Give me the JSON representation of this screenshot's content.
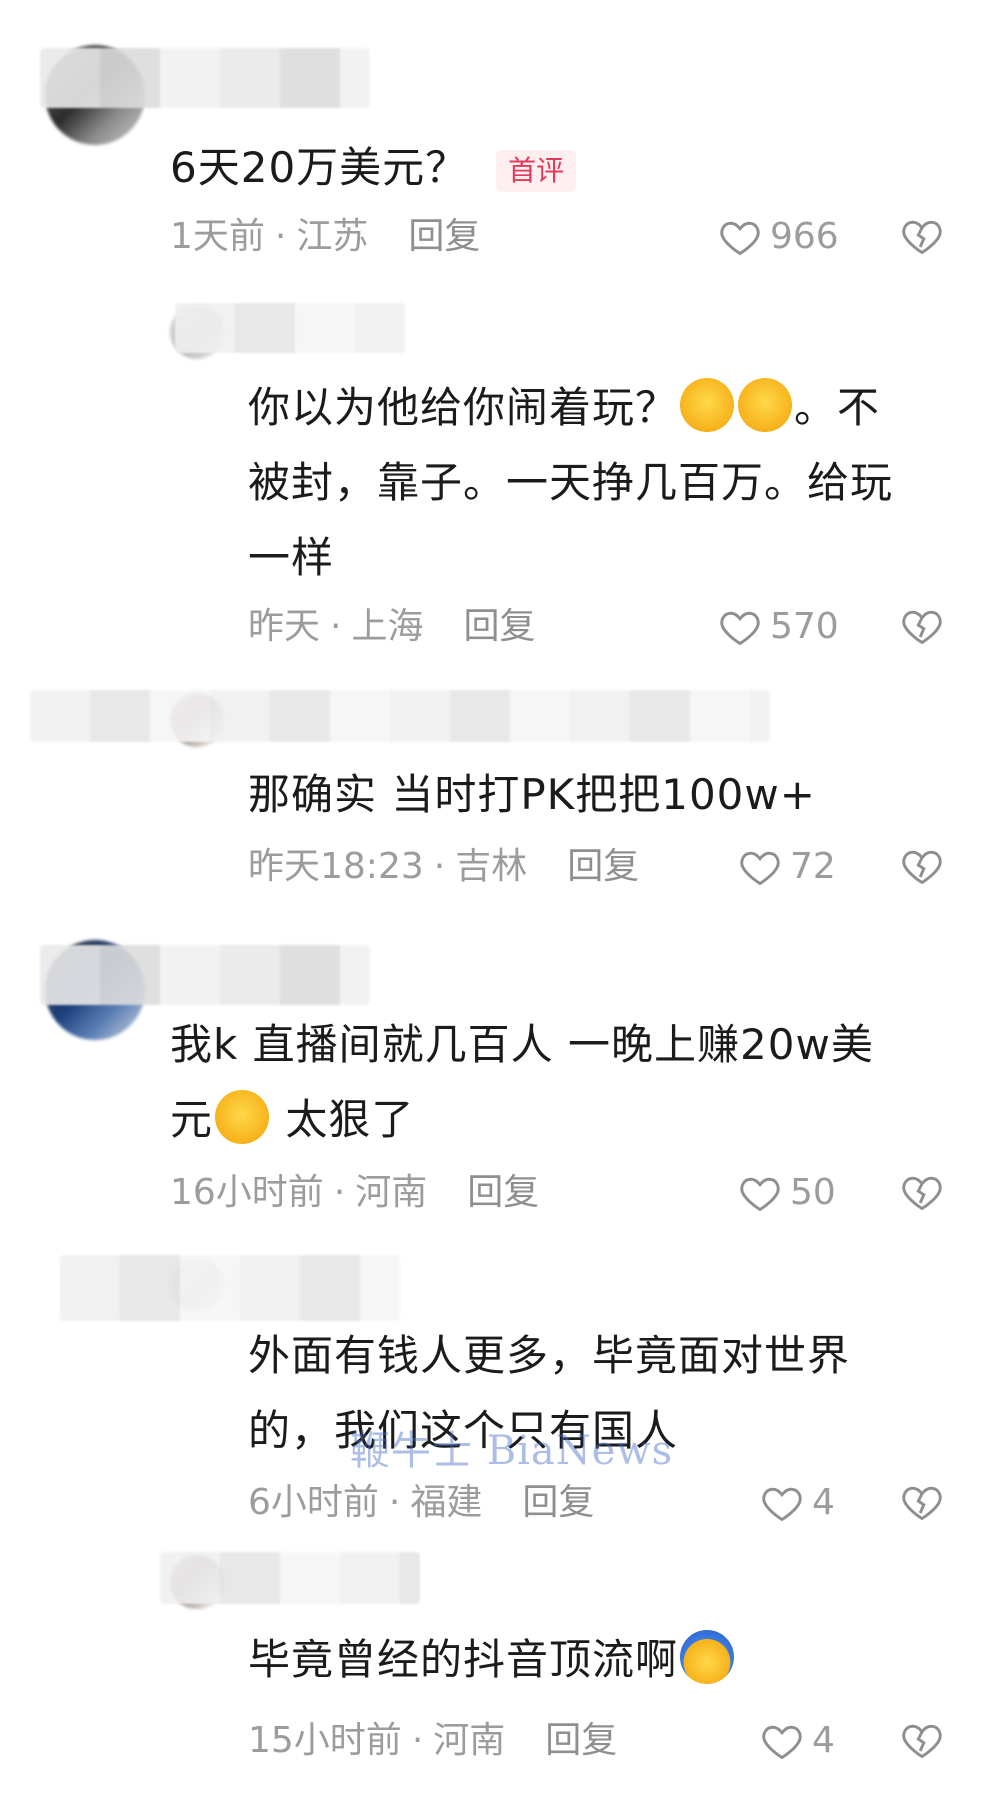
{
  "comments": [
    {
      "text": "6天20万美元？",
      "badge": "首评",
      "time": "1天前",
      "location": "江苏",
      "reply_label": "回复",
      "likes": "966"
    },
    {
      "text_before": "你以为他给你闹着玩？",
      "text_line1_end": "。不",
      "text_line2": "被封，靠子。一天挣几百万。给玩",
      "text_line3": "一样",
      "time": "昨天",
      "location": "上海",
      "reply_label": "回复",
      "likes": "570"
    },
    {
      "text": "那确实 当时打PK把把100w+",
      "time": "昨天18:23",
      "location": "吉林",
      "reply_label": "回复",
      "likes": "72"
    },
    {
      "text_line1": "我k 直播间就几百人 一晚上赚20w美",
      "text_line2_start": "元",
      "text_line2_end": " 太狠了",
      "time": "16小时前",
      "location": "河南",
      "reply_label": "回复",
      "likes": "50"
    },
    {
      "text_line1": "外面有钱人更多，毕竟面对世界",
      "text_line2": "的，我们这个只有国人",
      "time": "6小时前",
      "location": "福建",
      "reply_label": "回复",
      "likes": "4"
    },
    {
      "text": "毕竟曾经的抖音顶流啊",
      "time": "15小时前",
      "location": "河南",
      "reply_label": "回复",
      "likes": "4"
    }
  ],
  "separator": "·",
  "watermark": "鞭牛士 BiaNews",
  "icons": {
    "like": "heart-outline-icon",
    "dislike": "broken-heart-icon",
    "emoji_laugh": "tears-of-joy-emoji",
    "emoji_crazy": "crazy-face-emoji"
  },
  "colors": {
    "text": "#1b1b1b",
    "meta": "#9c9c9c",
    "badge_bg": "#fdeef0",
    "badge_text": "#e23a5b"
  }
}
